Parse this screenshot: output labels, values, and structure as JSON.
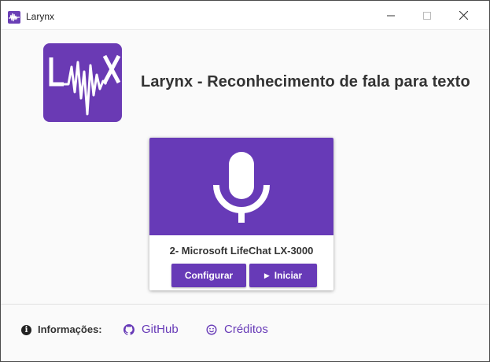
{
  "window": {
    "title": "Larynx",
    "icon": "waveform-icon",
    "controls": {
      "minimize": "—",
      "maximize": "☐",
      "close": "✕"
    }
  },
  "header": {
    "logo_text": "LWX",
    "title": "Larynx - Reconhecimento de fala para texto"
  },
  "device_card": {
    "media_icon": "microphone-icon",
    "device_name": "2- Microsoft LifeChat LX-3000",
    "configure_label": "Configurar",
    "start_label": "Iniciar",
    "start_icon": "play-icon"
  },
  "footer": {
    "info_icon": "info-icon",
    "info_label": "Informações:",
    "github_label": "GitHub",
    "github_icon": "github-icon",
    "credits_label": "Créditos",
    "credits_icon": "smile-icon"
  },
  "colors": {
    "accent": "#673ab7",
    "logo_bg": "#6a3ab4",
    "text": "#333333"
  }
}
